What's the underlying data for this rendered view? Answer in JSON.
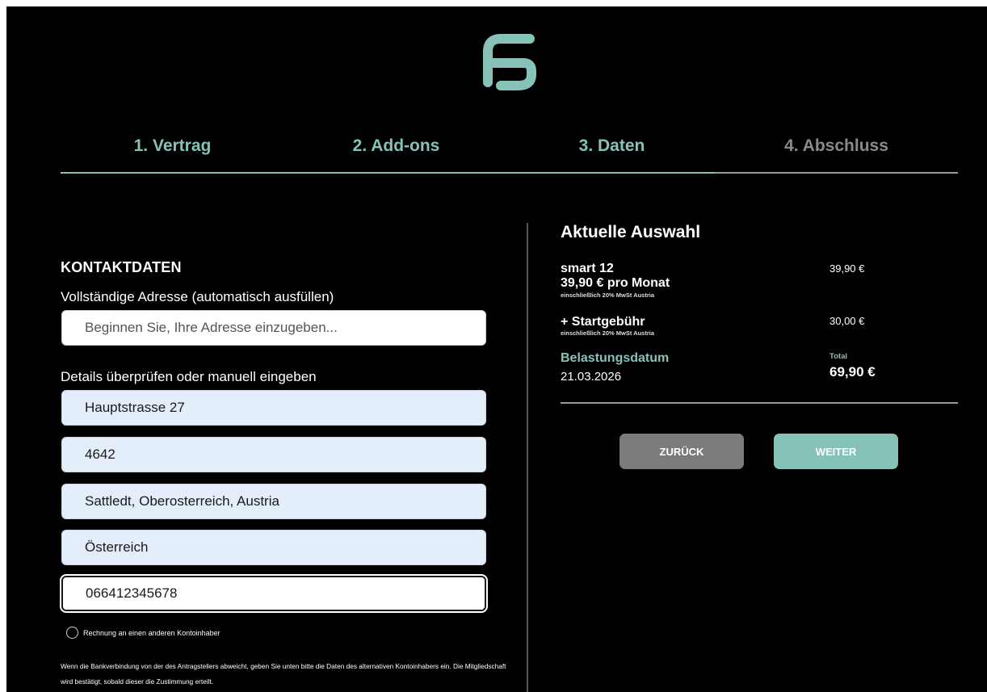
{
  "colors": {
    "accent": "#86c2b7",
    "background": "#000000",
    "inactive": "#8a8a8a",
    "field_filled": "#e3eefa"
  },
  "logo": {
    "icon": "brand-logo-icon"
  },
  "steps": [
    {
      "label": "1. Vertrag",
      "state": "done"
    },
    {
      "label": "2. Add-ons",
      "state": "done"
    },
    {
      "label": "3. Daten",
      "state": "current"
    },
    {
      "label": "4. Abschluss",
      "state": "upcoming"
    }
  ],
  "contact": {
    "title": "KONTAKTDATEN",
    "autofill_label": "Vollständige Adresse (automatisch ausfüllen)",
    "autofill_placeholder": "Beginnen Sie, Ihre Adresse einzugeben...",
    "manual_label": "Details überprüfen oder manuell eingeben",
    "street": "Hauptstrasse 27",
    "zip": "4642",
    "city": "Sattledt, Oberosterreich, Austria",
    "country": "Österreich",
    "phone": "066412345678",
    "other_holder_label": "Rechnung an einen anderen Kontoinhaber",
    "note": "Wenn die Bankverbindung von der des Antragstellers abweicht, geben Sie unten bitte die Daten des alternativen Kontoinhabers ein. Die Mitgliedschaft wird bestätigt, sobald dieser die Zustimmung erteilt."
  },
  "summary": {
    "title": "Aktuelle Auswahl",
    "plan_name": "smart 12",
    "plan_monthly": "39,90 € pro Monat",
    "plan_tax": "einschließlich 20% MwSt Austria",
    "plan_price": "39,90 €",
    "fee_name": "+ Startgebühr",
    "fee_tax": "einschließlich 20% MwSt Austria",
    "fee_price": "30,00 €",
    "date_label": "Belastungsdatum",
    "date_value": "21.03.2026",
    "total_label": "Total",
    "total_value": "69,90 €"
  },
  "buttons": {
    "back": "ZURÜCK",
    "next": "WEITER"
  }
}
